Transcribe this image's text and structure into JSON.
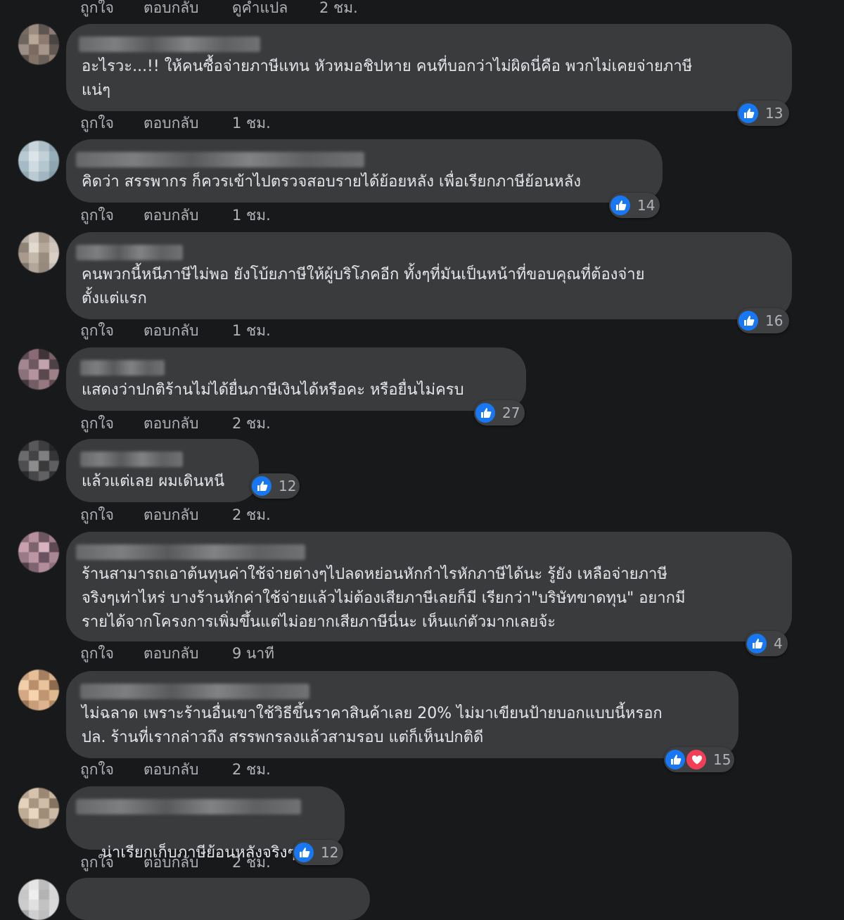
{
  "actions": {
    "like": "ถูกใจ",
    "reply": "ตอบกลับ",
    "translate": "ดูคำแปล"
  },
  "top_row": {
    "time": "2 ชม."
  },
  "comments": [
    {
      "text": "อะไรวะ...!! ให้คนซื้อจ่ายภาษีแทน หัวหมอชิปหาย คนที่บอกว่าไม่ผิดนี่คือ พวกไม่เคยจ่ายภาษี\nแน่ๆ",
      "time": "1 ชม.",
      "reactions": "13"
    },
    {
      "text": "คิดว่า สรรพากร ก็ควรเข้าไปตรวจสอบรายได้ย้อยหลัง เพื่อเรียกภาษีย้อนหลัง",
      "time": "1 ชม.",
      "reactions": "14"
    },
    {
      "text": "คนพวกนี้หนีภาษีไม่พอ ยังโบ้ยภาษีให้ผู้บริโภคอีก ทั้งๆที่มันเป็นหน้าที่ขอบคุณที่ต้องจ่าย\nตั้งแต่แรก",
      "time": "1 ชม.",
      "reactions": "16"
    },
    {
      "text": "แสดงว่าปกติร้านไม่ได้ยื่นภาษีเงินได้หรือคะ หรือยื่นไม่ครบ",
      "time": "2 ชม.",
      "reactions": "27"
    },
    {
      "text": "แล้วแต่เลย ผมเดินหนี",
      "time": "2 ชม.",
      "reactions": "12"
    },
    {
      "text": "ร้านสามารถเอาต้นทุนค่าใช้จ่ายต่างๆไปลดหย่อนหักกำไรหักภาษีได้นะ รู้ยัง เหลือจ่ายภาษี\nจริงๆเท่าไหร่ บางร้านหักค่าใช้จ่ายแล้วไม่ต้องเสียภาษีเลยก็มี เรียกว่า\"บริษัทขาดทุน\" อยากมี\nรายได้จากโครงการเพิ่มขึ้นแต่ไม่อยากเสียภาษีนี่นะ เห็นแก่ตัวมากเลยจ้ะ",
      "time": "9 นาที",
      "reactions": "4"
    },
    {
      "text": "ไม่ฉลาด เพราะร้านอื่นเขาใช้วิธีขึ้นราคาสินค้าเลย 20% ไม่มาเขียนป้ายบอกแบบนี้หรอก\nปล. ร้านที่เรากล่าวถึง สรรพกรลงแล้วสามรอบ แต่ก็เห็นปกติดี",
      "time": "2 ชม.",
      "reactions": "15"
    },
    {
      "text": "น่าเรียกเก็บภาษีย้อนหลังจริงๆ",
      "time": "2 ชม.",
      "reactions": "12"
    }
  ],
  "colors": {
    "background": "#18191a",
    "bubble": "#3a3b3c",
    "text": "#e4e6eb",
    "muted": "#b0b3b8",
    "like": "#1877f2",
    "love": "#f33e58"
  }
}
